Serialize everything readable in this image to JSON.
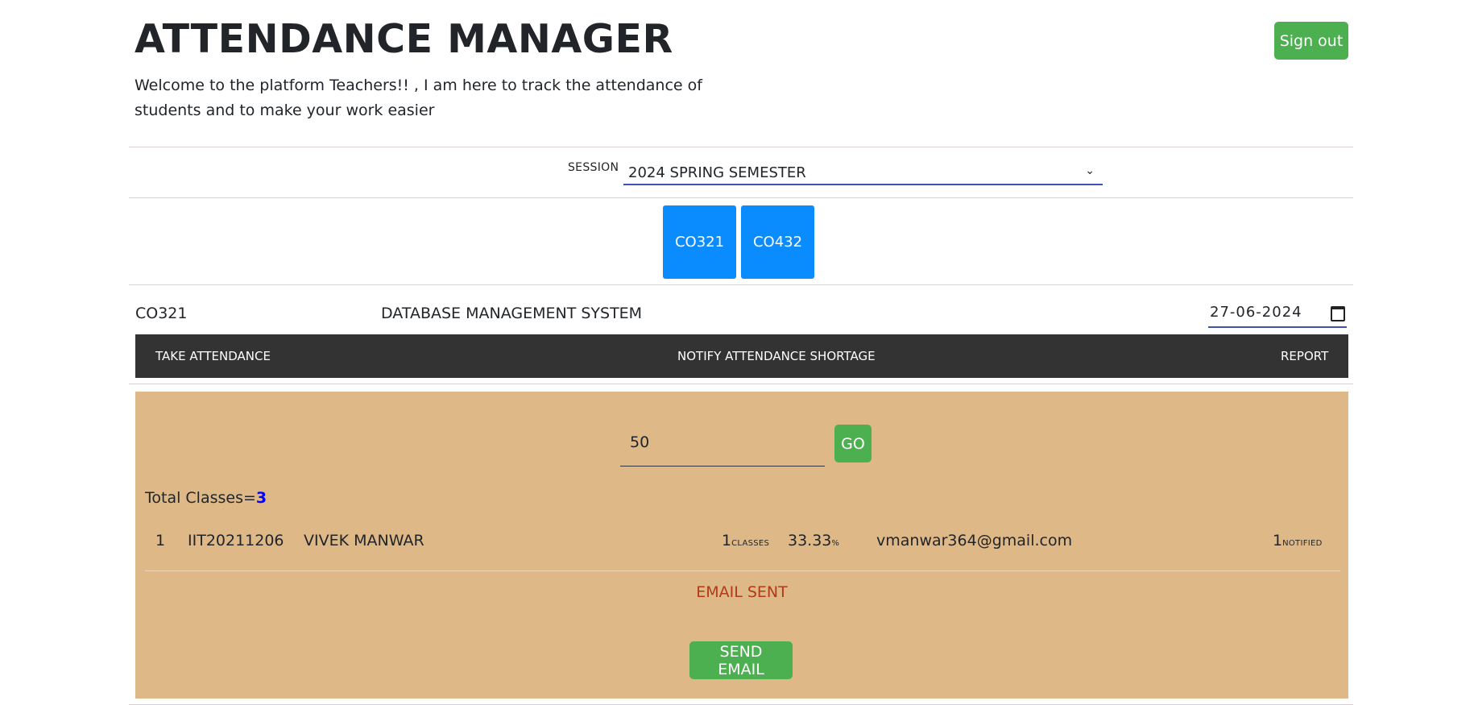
{
  "header": {
    "title": "ATTENDANCE MANAGER",
    "subtitle": "Welcome to the platform Teachers!! , I am here to track the attendance of students and to make your work easier",
    "signout_label": "Sign out"
  },
  "session": {
    "label": "SESSION",
    "selected": "2024 SPRING SEMESTER"
  },
  "courses": [
    "CO321",
    "CO432"
  ],
  "course_detail": {
    "code": "CO321",
    "name": "DATABASE MANAGEMENT SYSTEM",
    "date": "27-06-2024"
  },
  "nav": {
    "take_attendance": "TAKE ATTENDANCE",
    "notify_shortage": "NOTIFY ATTENDANCE SHORTAGE",
    "report": "REPORT"
  },
  "shortage": {
    "threshold": "50",
    "go_label": "GO",
    "total_label": "Total Classes=",
    "total_value": "3",
    "rows": [
      {
        "index": "1",
        "roll": "IIT20211206",
        "name": "VIVEK MANWAR",
        "classes": "1",
        "classes_unit": "CLASSES",
        "percent": "33.33",
        "percent_unit": "%",
        "email": "vmanwar364@gmail.com",
        "notified": "1",
        "notified_unit": "NOTIFIED"
      }
    ],
    "status": "EMAIL SENT",
    "send_label": "SEND EMAIL"
  },
  "colors": {
    "accent_green": "#4caf50",
    "course_blue": "#0a8cff",
    "panel_tan": "#deb887",
    "navbar_dark": "#333333",
    "status_red": "#b03a1a"
  }
}
